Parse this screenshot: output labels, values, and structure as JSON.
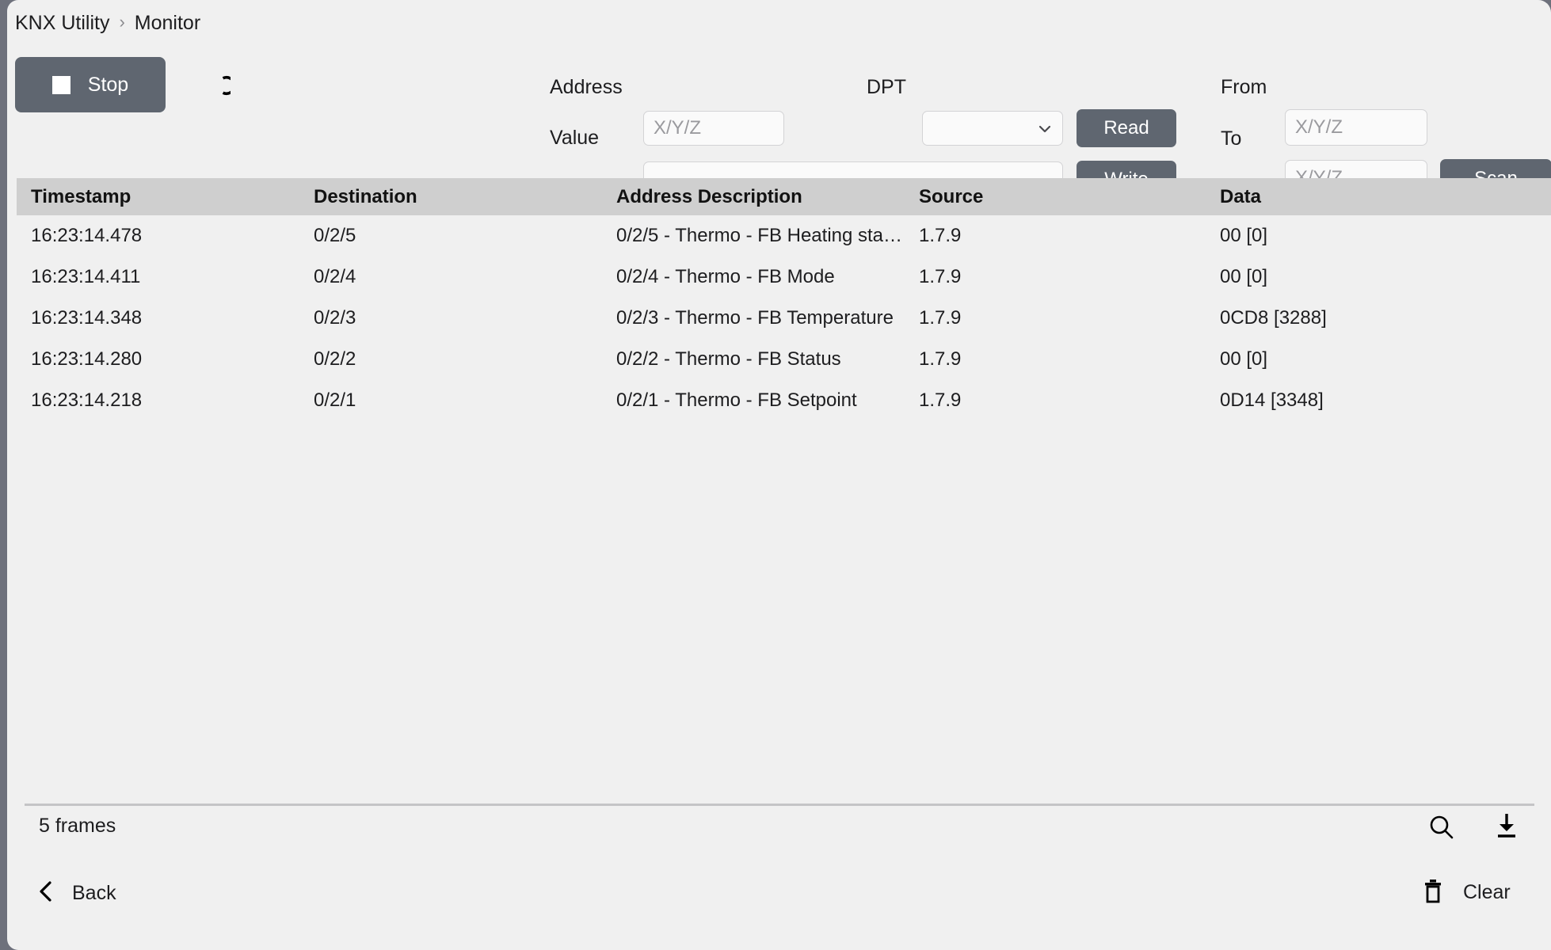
{
  "breadcrumb": {
    "root": "KNX Utility",
    "separator": "›",
    "current": "Monitor"
  },
  "toolbar": {
    "stop_label": "Stop",
    "spinner_icon": "loading-spinner-icon",
    "address_label": "Address",
    "address_placeholder": "X/Y/Z",
    "address_value": "",
    "value_label": "Value",
    "value_placeholder": "",
    "value_value": "",
    "dpt_label": "DPT",
    "dpt_selected": "",
    "dpt_chevron_icon": "chevron-down-icon",
    "read_label": "Read",
    "write_label": "Write",
    "from_label": "From",
    "from_placeholder": "X/Y/Z",
    "from_value": "",
    "to_label": "To",
    "to_placeholder": "X/Y/Z",
    "to_value": "",
    "scan_label": "Scan"
  },
  "table": {
    "columns": [
      {
        "key": "timestamp",
        "label": "Timestamp"
      },
      {
        "key": "destination",
        "label": "Destination"
      },
      {
        "key": "description",
        "label": "Address Description"
      },
      {
        "key": "source",
        "label": "Source"
      },
      {
        "key": "data",
        "label": "Data"
      }
    ],
    "rows": [
      {
        "timestamp": "16:23:14.478",
        "destination": "0/2/5",
        "description": "0/2/5 - Thermo - FB Heating sta…",
        "source": "1.7.9",
        "data": "00 [0]"
      },
      {
        "timestamp": "16:23:14.411",
        "destination": "0/2/4",
        "description": "0/2/4 - Thermo - FB Mode",
        "source": "1.7.9",
        "data": "00 [0]"
      },
      {
        "timestamp": "16:23:14.348",
        "destination": "0/2/3",
        "description": "0/2/3 - Thermo - FB Temperature",
        "source": "1.7.9",
        "data": "0CD8 [3288]"
      },
      {
        "timestamp": "16:23:14.280",
        "destination": "0/2/2",
        "description": "0/2/2 - Thermo - FB Status",
        "source": "1.7.9",
        "data": "00 [0]"
      },
      {
        "timestamp": "16:23:14.218",
        "destination": "0/2/1",
        "description": "0/2/1 - Thermo - FB Setpoint",
        "source": "1.7.9",
        "data": "0D14 [3348]"
      }
    ]
  },
  "footer": {
    "frames_count": "5 frames",
    "search_icon": "search-icon",
    "download_icon": "download-icon",
    "back_label": "Back",
    "back_icon": "chevron-left-icon",
    "clear_label": "Clear",
    "clear_icon": "trash-icon"
  },
  "colors": {
    "window_frame": "#6e717c",
    "surface": "#f0f0f0",
    "button_primary": "#5f6670",
    "table_header": "#cfcfcf",
    "input_bg": "#fafafa",
    "input_border": "#d3d3d5",
    "text": "#1d1d1f",
    "muted_text": "#9a9a9e",
    "divider": "#c4c4c6"
  }
}
